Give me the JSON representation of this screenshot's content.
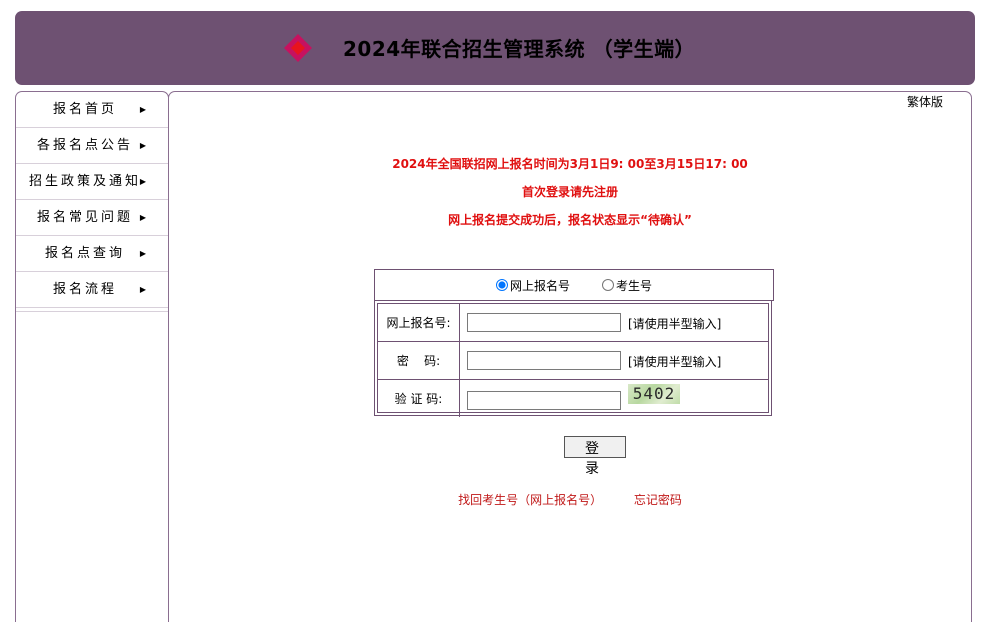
{
  "header": {
    "title": "2024年联合招生管理系统 （学生端）",
    "logo_icon": "diamond-cluster-logo",
    "colors": {
      "header_bg": "#6e5172",
      "logo_magenta": "#c8115f",
      "logo_red": "#e8141e"
    }
  },
  "sidebar": {
    "items": [
      {
        "label": "报名首页",
        "icon": "triangle-right-icon"
      },
      {
        "label": "各报名点公告",
        "icon": "triangle-right-icon"
      },
      {
        "label": "招生政策及通知",
        "icon": "triangle-right-icon"
      },
      {
        "label": "报名常见问题",
        "icon": "triangle-right-icon"
      },
      {
        "label": "报名点查询",
        "icon": "triangle-right-icon"
      },
      {
        "label": "报名流程",
        "icon": "triangle-right-icon"
      }
    ]
  },
  "main": {
    "traditional_link": "繁体版",
    "notices": [
      "2024年全国联招网上报名时间为3月1日9: 00至3月15日17: 00",
      "首次登录请先注册",
      "网上报名提交成功后，报名状态显示“待确认”"
    ],
    "notice_color": "#e01010",
    "login_type": {
      "options": [
        "网上报名号",
        "考生号"
      ],
      "selected": "网上报名号"
    },
    "form": {
      "username_label": "网上报名号:",
      "username_value": "",
      "username_hint": "[请使用半型输入]",
      "password_label": "密    码:",
      "password_value": "",
      "password_hint": "[请使用半型输入]",
      "captcha_label": "验 证 码:",
      "captcha_value": "",
      "captcha_text": "5402"
    },
    "login_button": "登录",
    "links": {
      "recover": "找回考生号（网上报名号）",
      "forgot": "忘记密码"
    }
  }
}
